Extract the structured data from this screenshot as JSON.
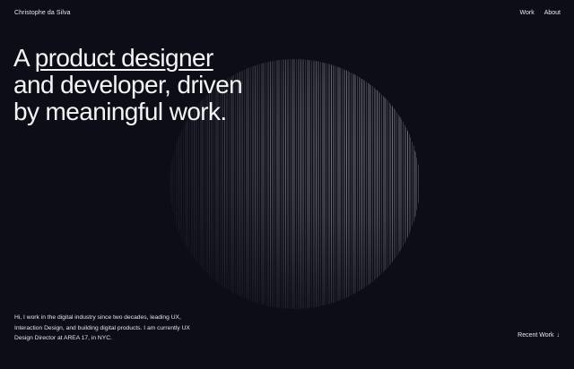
{
  "header": {
    "site_name": "Christophe da Silva",
    "nav": [
      {
        "label": "Work"
      },
      {
        "label": "About"
      }
    ]
  },
  "hero": {
    "headline_prefix": "A ",
    "headline_highlight": "product designer",
    "headline_line2": "and developer, driven",
    "headline_line3": "by meaningful work."
  },
  "intro": {
    "text": "Hi, I work in the digital industry since two decades, leading UX, Interaction Design, and building digital products. I am currently UX Design Director at AREA 17, in NYC."
  },
  "footer": {
    "recent_label": "Recent Work",
    "recent_icon": "arrow-down-icon",
    "recent_glyph": "↓"
  },
  "colors": {
    "background": "#0d0d17",
    "text": "#f2f2f4"
  }
}
